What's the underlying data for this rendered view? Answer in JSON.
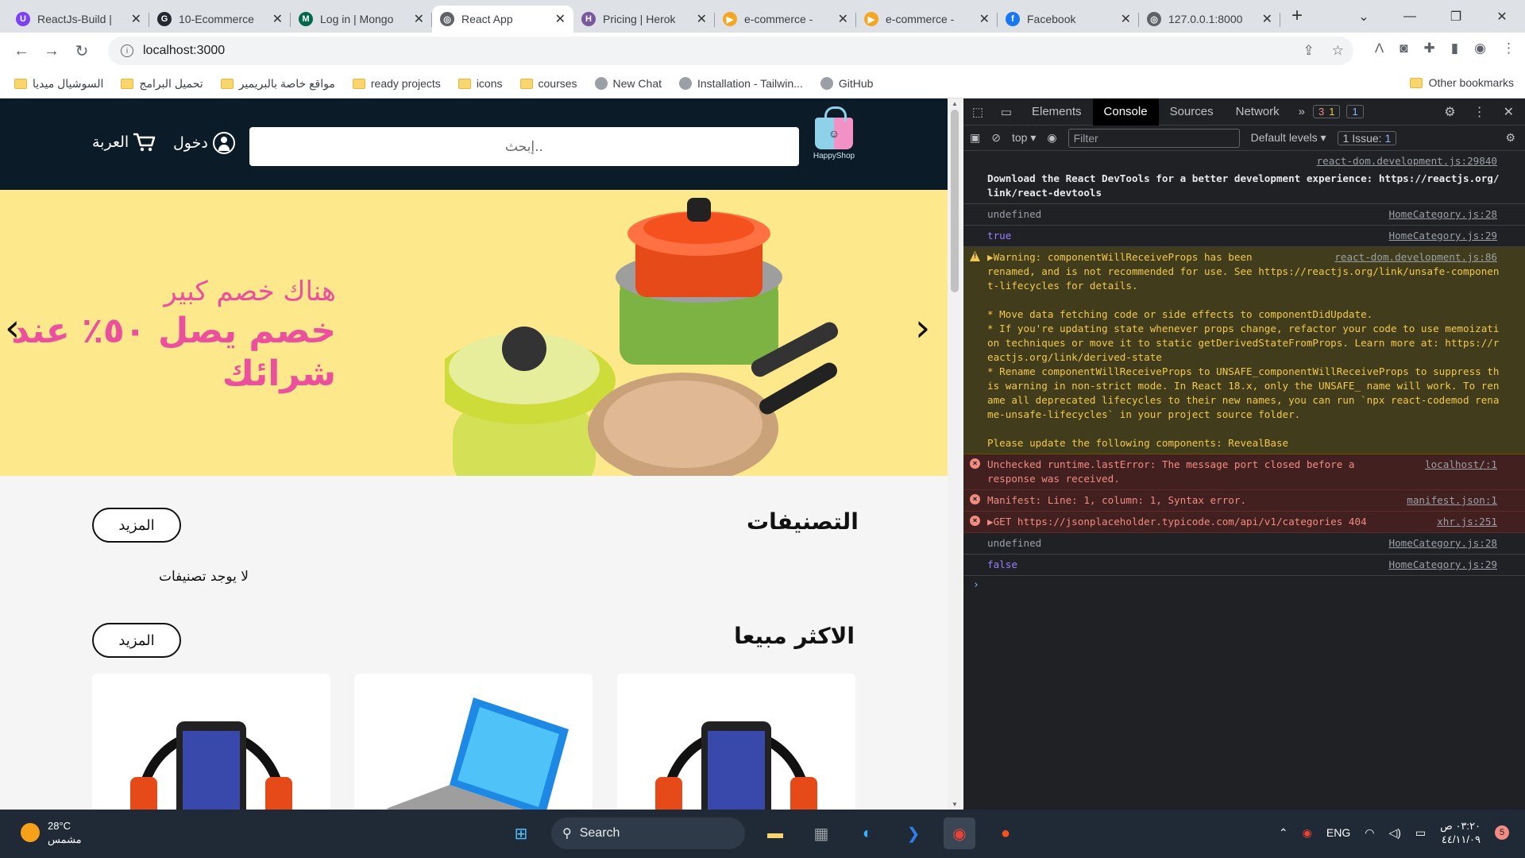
{
  "browser": {
    "tabs": [
      {
        "title": "ReactJs-Build |",
        "color": "#7b42f5",
        "glyph": "U"
      },
      {
        "title": "10-Ecommerce",
        "color": "#24292f",
        "glyph": "G"
      },
      {
        "title": "Log in | Mongo",
        "color": "#00684a",
        "glyph": "M"
      },
      {
        "title": "React App",
        "color": "#5f6368",
        "glyph": "◎",
        "active": true
      },
      {
        "title": "Pricing | Herok",
        "color": "#79589f",
        "glyph": "H"
      },
      {
        "title": "e-commerce -",
        "color": "#f5a623",
        "glyph": "▶"
      },
      {
        "title": "e-commerce -",
        "color": "#f5a623",
        "glyph": "▶"
      },
      {
        "title": "Facebook",
        "color": "#1877f2",
        "glyph": "f"
      },
      {
        "title": "127.0.0.1:8000",
        "color": "#5f6368",
        "glyph": "◎"
      }
    ],
    "url": "localhost:3000",
    "bookmarks": [
      "السوشيال ميديا",
      "تحميل البرامج",
      "مواقع خاصة بالبريمير",
      "ready projects",
      "icons",
      "courses",
      "New Chat",
      "Installation - Tailwin...",
      "GitHub"
    ],
    "other_bookmarks": "Other bookmarks"
  },
  "site": {
    "logo_text": "HappyShop",
    "search_placeholder": "إبحث..",
    "login_label": "دخول",
    "cart_label": "العربة",
    "slide": {
      "line1": "هناك خصم كبير",
      "line2": "خصم يصل ٥٠٪ عند",
      "line3": "شرائك"
    },
    "categories_title": "التصنيفات",
    "more_label": "المزيد",
    "no_categories": "لا يوجد تصنيفات",
    "bestseller_title": "الاكثر مبيعا"
  },
  "devtools": {
    "tabs": [
      "Elements",
      "Console",
      "Sources",
      "Network"
    ],
    "errors_count": "3",
    "warnings_count": "1",
    "info_count": "1",
    "context": "top",
    "filter_placeholder": "Filter",
    "levels": "Default levels",
    "issues": "1 Issue:",
    "issues_count": "1",
    "messages": [
      {
        "type": "info",
        "src": "react-dom.development.js:29840",
        "text": "Download the React DevTools for a better development experience: https://reactjs.org/link/react-devtools",
        "bold": true
      },
      {
        "type": "plain",
        "src": "HomeCategory.js:28",
        "text": "undefined"
      },
      {
        "type": "bool",
        "src": "HomeCategory.js:29",
        "text": "true"
      },
      {
        "type": "warn",
        "src": "react-dom.development.js:86",
        "text": "▶Warning: componentWillReceiveProps has been\nrenamed, and is not recommended for use. See https://reactjs.org/link/unsafe-component-lifecycles for details.\n\n* Move data fetching code or side effects to componentDidUpdate.\n* If you're updating state whenever props change, refactor your code to use memoization techniques or move it to static getDerivedStateFromProps. Learn more at: https://reactjs.org/link/derived-state\n* Rename componentWillReceiveProps to UNSAFE_componentWillReceiveProps to suppress this warning in non-strict mode. In React 18.x, only the UNSAFE_ name will work. To rename all deprecated lifecycles to their new names, you can run `npx react-codemod rename-unsafe-lifecycles` in your project source folder.\n\nPlease update the following components: RevealBase"
      },
      {
        "type": "err",
        "src": "localhost/:1",
        "text": "Unchecked runtime.lastError: The message port closed before a\nresponse was received."
      },
      {
        "type": "err",
        "src": "manifest.json:1",
        "text": "Manifest: Line: 1, column: 1, Syntax error."
      },
      {
        "type": "err",
        "src": "xhr.js:251",
        "text": "▶GET https://jsonplaceholder.typicode.com/api/v1/categories 404"
      },
      {
        "type": "plain",
        "src": "HomeCategory.js:28",
        "text": "undefined"
      },
      {
        "type": "bool",
        "src": "HomeCategory.js:29",
        "text": "false"
      }
    ]
  },
  "taskbar": {
    "temp": "28°C",
    "weather": "مشمس",
    "search": "Search",
    "lang": "ENG",
    "time": "٠٣:٢٠ ص",
    "date": "٤٤/١١/٠٩",
    "badge": "5"
  }
}
